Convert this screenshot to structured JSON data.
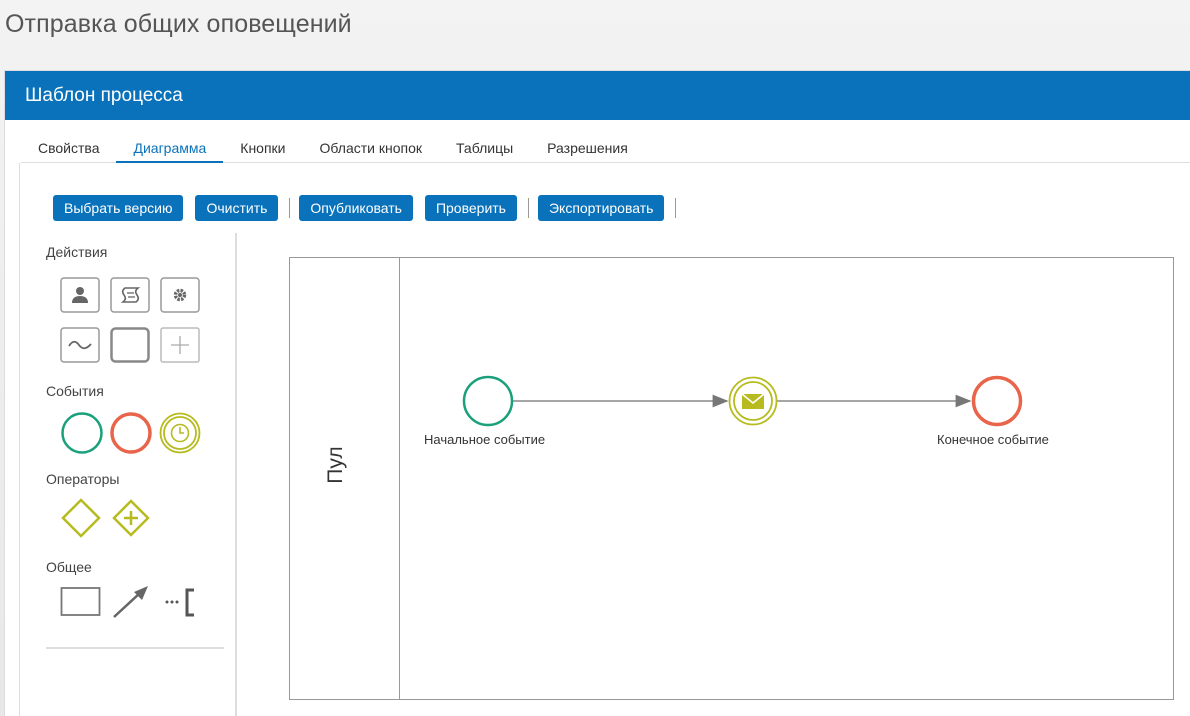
{
  "page": {
    "title": "Отправка общих оповещений"
  },
  "panel": {
    "header": "Шаблон процесса"
  },
  "tabs": [
    {
      "label": "Свойства",
      "active": false
    },
    {
      "label": "Диаграмма",
      "active": true
    },
    {
      "label": "Кнопки",
      "active": false
    },
    {
      "label": "Области кнопок",
      "active": false
    },
    {
      "label": "Таблицы",
      "active": false
    },
    {
      "label": "Разрешения",
      "active": false
    }
  ],
  "toolbar": {
    "select_version": "Выбрать версию",
    "clear": "Очистить",
    "publish": "Опубликовать",
    "check": "Проверить",
    "export": "Экспортировать"
  },
  "palette": {
    "actions_title": "Действия",
    "events_title": "События",
    "operators_title": "Операторы",
    "general_title": "Общее",
    "actions": [
      "user-task-icon",
      "script-task-icon",
      "service-task-icon",
      "subprocess-icon",
      "task-icon",
      "add-icon"
    ],
    "events": [
      "start-event-icon",
      "end-event-icon",
      "timer-event-icon"
    ],
    "operators": [
      "exclusive-gateway-icon",
      "parallel-gateway-icon"
    ],
    "general": [
      "pool-icon",
      "connector-icon",
      "annotation-icon"
    ]
  },
  "diagram": {
    "pool_label": "Пул",
    "start_label": "Начальное событие",
    "end_label": "Конечное событие",
    "message_event": "envelope-icon"
  },
  "colors": {
    "accent": "#0a72ba",
    "start_event": "#1aa07a",
    "end_event": "#e8644a",
    "intermediate_event": "#b7bb1f"
  }
}
